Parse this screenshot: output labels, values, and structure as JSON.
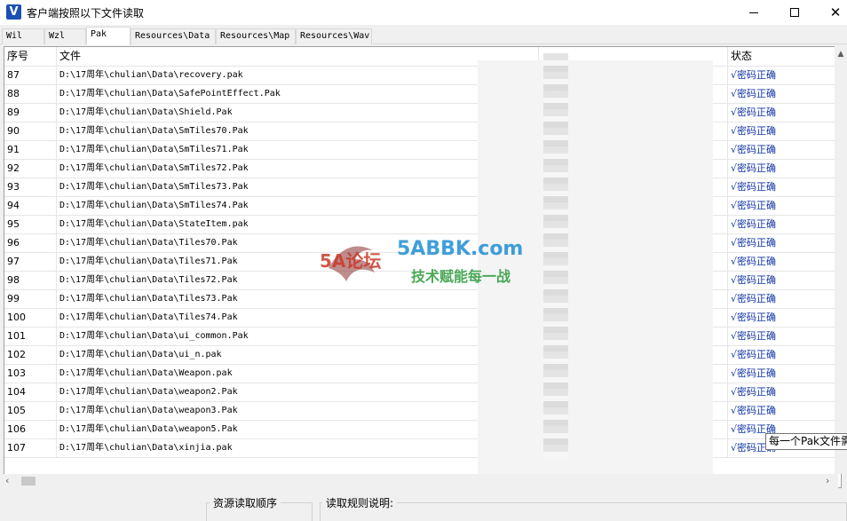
{
  "window": {
    "title": "客户端按照以下文件读取",
    "icon_letter": "V",
    "controls": {
      "minimize": "—",
      "maximize": "☐",
      "close": "✕"
    }
  },
  "tabs": [
    "Wil",
    "Wzl",
    "Pak",
    "Resources\\Data",
    "Resources\\Map",
    "Resources\\Wav"
  ],
  "active_tab": "Pak",
  "table": {
    "headers": {
      "seq": "序号",
      "file": "文件",
      "password": "",
      "status": "状态"
    },
    "rows": [
      {
        "seq": "87",
        "file": "D:\\17周年\\chulian\\Data\\recovery.pak",
        "status": "√密码正确"
      },
      {
        "seq": "88",
        "file": "D:\\17周年\\chulian\\Data\\SafePointEffect.Pak",
        "status": "√密码正确"
      },
      {
        "seq": "89",
        "file": "D:\\17周年\\chulian\\Data\\Shield.Pak",
        "status": "√密码正确"
      },
      {
        "seq": "90",
        "file": "D:\\17周年\\chulian\\Data\\SmTiles70.Pak",
        "status": "√密码正确"
      },
      {
        "seq": "91",
        "file": "D:\\17周年\\chulian\\Data\\SmTiles71.Pak",
        "status": "√密码正确"
      },
      {
        "seq": "92",
        "file": "D:\\17周年\\chulian\\Data\\SmTiles72.Pak",
        "status": "√密码正确"
      },
      {
        "seq": "93",
        "file": "D:\\17周年\\chulian\\Data\\SmTiles73.Pak",
        "status": "√密码正确"
      },
      {
        "seq": "94",
        "file": "D:\\17周年\\chulian\\Data\\SmTiles74.Pak",
        "status": "√密码正确"
      },
      {
        "seq": "95",
        "file": "D:\\17周年\\chulian\\Data\\StateItem.pak",
        "status": "√密码正确"
      },
      {
        "seq": "96",
        "file": "D:\\17周年\\chulian\\Data\\Tiles70.Pak",
        "status": "√密码正确"
      },
      {
        "seq": "97",
        "file": "D:\\17周年\\chulian\\Data\\Tiles71.Pak",
        "status": "√密码正确"
      },
      {
        "seq": "98",
        "file": "D:\\17周年\\chulian\\Data\\Tiles72.Pak",
        "status": "√密码正确"
      },
      {
        "seq": "99",
        "file": "D:\\17周年\\chulian\\Data\\Tiles73.Pak",
        "status": "√密码正确"
      },
      {
        "seq": "100",
        "file": "D:\\17周年\\chulian\\Data\\Tiles74.Pak",
        "status": "√密码正确"
      },
      {
        "seq": "101",
        "file": "D:\\17周年\\chulian\\Data\\ui_common.Pak",
        "status": "√密码正确"
      },
      {
        "seq": "102",
        "file": "D:\\17周年\\chulian\\Data\\ui_n.pak",
        "status": "√密码正确"
      },
      {
        "seq": "103",
        "file": "D:\\17周年\\chulian\\Data\\Weapon.pak",
        "status": "√密码正确"
      },
      {
        "seq": "104",
        "file": "D:\\17周年\\chulian\\Data\\weapon2.Pak",
        "status": "√密码正确"
      },
      {
        "seq": "105",
        "file": "D:\\17周年\\chulian\\Data\\weapon3.Pak",
        "status": "√密码正确"
      },
      {
        "seq": "106",
        "file": "D:\\17周年\\chulian\\Data\\weapon5.Pak",
        "status": "√密码正确"
      },
      {
        "seq": "107",
        "file": "D:\\17周年\\chulian\\Data\\xinjia.pak",
        "status": "√密码正确"
      }
    ]
  },
  "bottom": {
    "order_label": "资源读取顺序",
    "rules_label": "读取规则说明:"
  },
  "tooltip": "每一个Pak文件需",
  "watermark": {
    "logo_text": "5A论坛",
    "domain": "5ABBK.com",
    "slogan": "技术赋能每一战"
  },
  "colors": {
    "status_text": "#1034a6",
    "watermark_domain": "#1f8fd4",
    "watermark_slogan": "#2c9a3a",
    "watermark_logo": "#c83a2a"
  }
}
